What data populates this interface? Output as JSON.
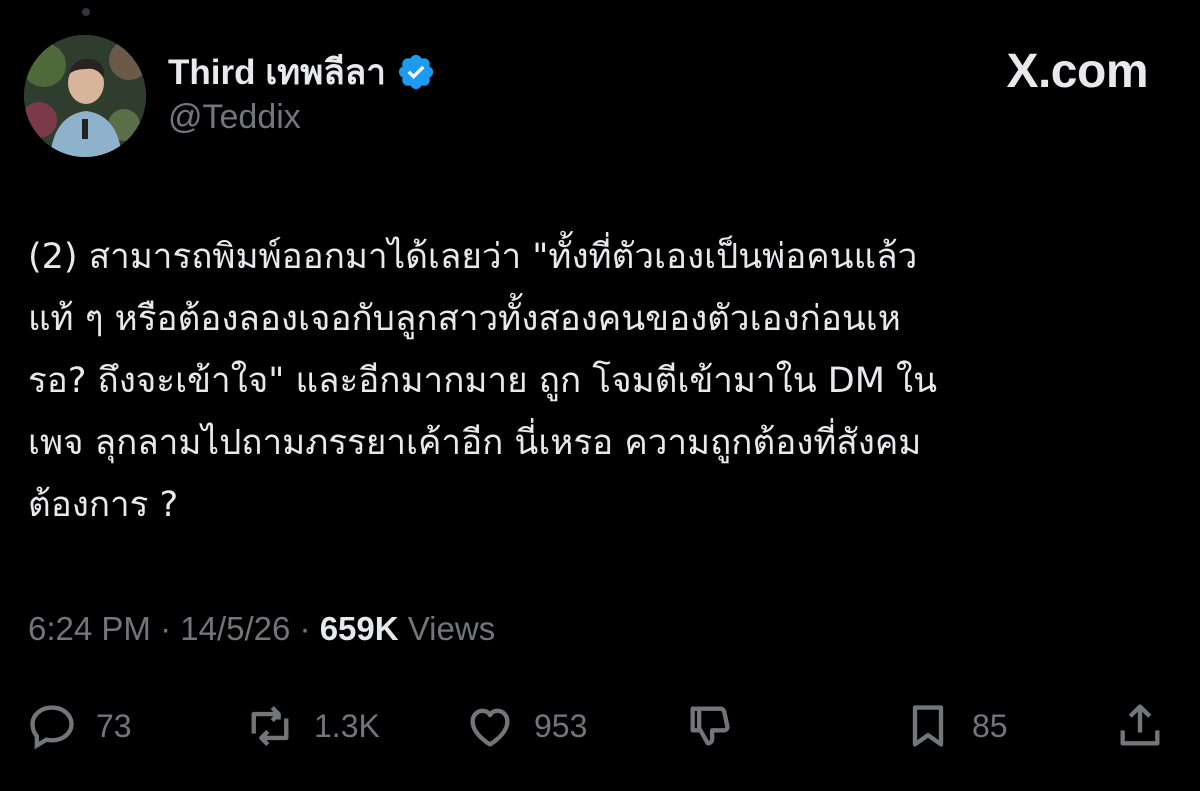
{
  "author": {
    "display_name": "Third เทพลีลา",
    "handle": "@Teddix",
    "verified": true,
    "verified_color": "#1d9bf0"
  },
  "brand": {
    "label": "X.com"
  },
  "tweet": {
    "lines": [
      "(2) สามารถพิมพ์ออกมาได้เลยว่า \"ทั้งที่ตัวเองเป็นพ่อคนแล้ว",
      "แท้ ๆ หรือต้องลองเจอกับลูกสาวทั้งสองคนของตัวเองก่อนเห",
      "รอ? ถึงจะเข้าใจ\" และอีกมากมาย ถูก โจมตีเข้ามาใน DM ใน",
      "เพจ ลุกลามไปถามภรรยาเค้าอีก นี่เหรอ ความถูกต้องที่สังคม",
      "ต้องการ ?"
    ]
  },
  "meta": {
    "time": "6:24 PM",
    "separator": "·",
    "date": "14/5/26",
    "views_count": "659K",
    "views_label": "Views"
  },
  "actions": {
    "replies": "73",
    "reposts": "1.3K",
    "likes": "953",
    "bookmarks": "85"
  },
  "colors": {
    "background": "#000000",
    "text_primary": "#e7e9ea",
    "text_secondary": "#71767b",
    "accent": "#1d9bf0"
  }
}
